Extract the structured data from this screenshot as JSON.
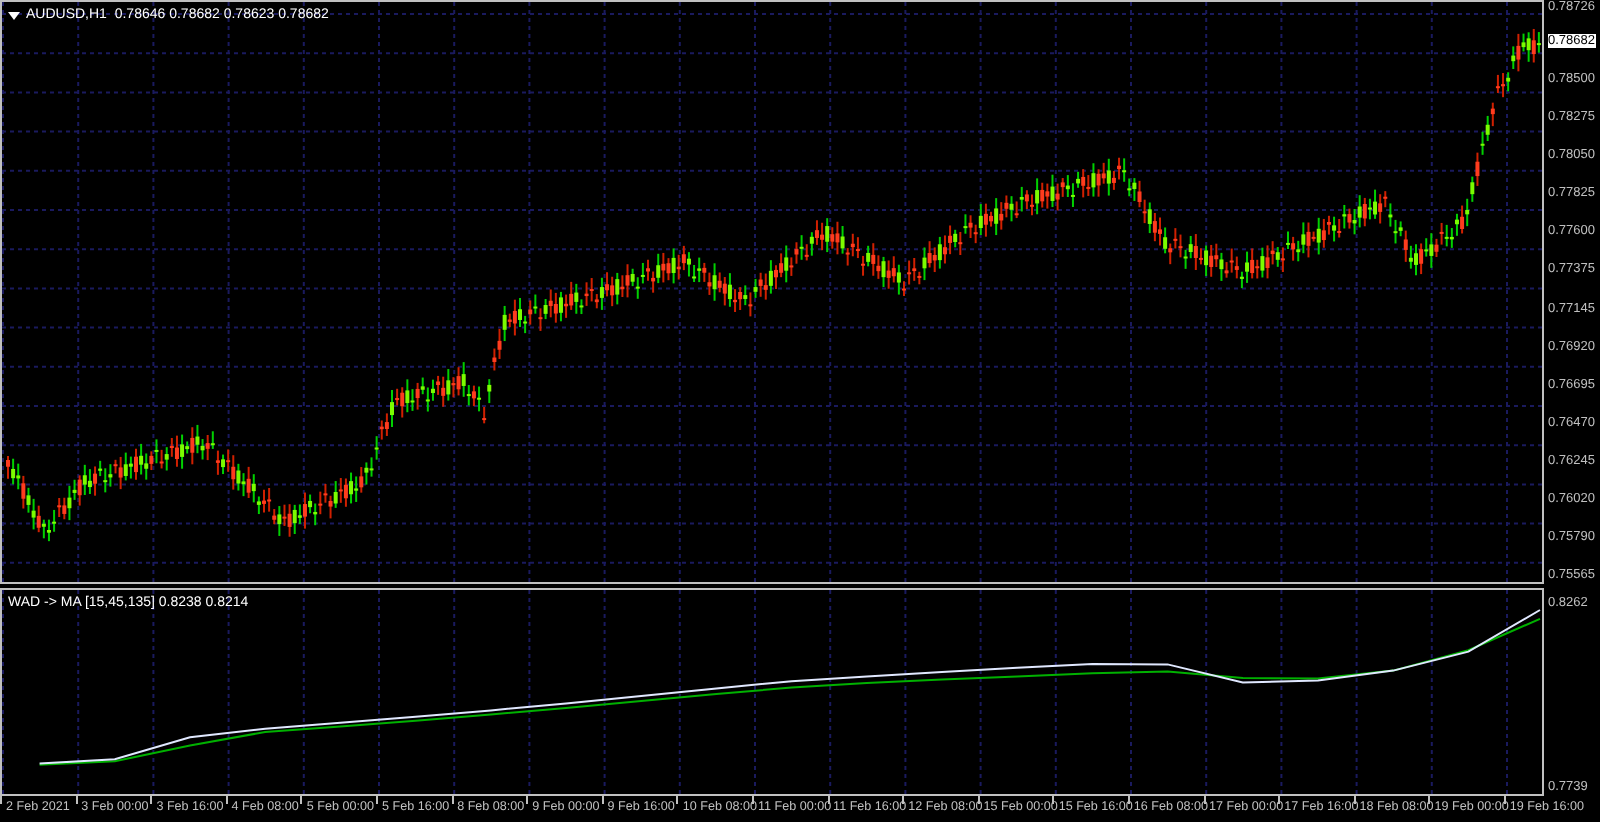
{
  "main_panel": {
    "header": "AUDUSD,H1  0.78646 0.78682 0.78623 0.78682",
    "current_price": "0.78682",
    "price_axis": [
      "0.78726",
      "0.78500",
      "0.78275",
      "0.78050",
      "0.77825",
      "0.77600",
      "0.77375",
      "0.77145",
      "0.76920",
      "0.76695",
      "0.76470",
      "0.76245",
      "0.76020",
      "0.75790",
      "0.75565"
    ]
  },
  "indicator_panel": {
    "header": "WAD -> MA [15,45,135] 0.8238 0.8214",
    "chart_data": {
      "type": "line",
      "categories": [
        "2 Feb 2021",
        "3 Feb 00:00",
        "3 Feb 16:00",
        "4 Feb 08:00",
        "5 Feb 00:00",
        "5 Feb 16:00",
        "8 Feb 08:00",
        "9 Feb 00:00",
        "9 Feb 16:00",
        "10 Feb 08:00",
        "11 Feb 00:00",
        "11 Feb 16:00",
        "12 Feb 08:00",
        "15 Feb 00:00",
        "15 Feb 16:00",
        "16 Feb 08:00",
        "17 Feb 00:00",
        "17 Feb 16:00",
        "18 Feb 08:00",
        "19 Feb 00:00",
        "19 Feb 16:00"
      ],
      "series": [
        {
          "color": "#e0e8ff",
          "values": [
            0.7814,
            0.7827,
            0.7889,
            0.7913,
            0.793,
            0.7947,
            0.7965,
            0.7985,
            0.8006,
            0.8028,
            0.8048,
            0.8062,
            0.8074,
            0.8086,
            0.8097,
            0.8096,
            0.8045,
            0.805,
            0.8078,
            0.8132,
            0.825
          ]
        },
        {
          "color": "#00b000",
          "values": [
            0.7811,
            0.7821,
            0.7866,
            0.7904,
            0.792,
            0.7936,
            0.7954,
            0.7972,
            0.7992,
            0.8012,
            0.803,
            0.8043,
            0.8053,
            0.8062,
            0.8071,
            0.8076,
            0.8057,
            0.8056,
            0.8078,
            0.8136,
            0.8225
          ]
        }
      ],
      "ylim": [
        0.7728,
        0.8307
      ],
      "yticks": [
        {
          "value": 0.8262,
          "label": "0.8262"
        },
        {
          "value": 0.7739,
          "label": "0.7739"
        }
      ]
    }
  }
}
